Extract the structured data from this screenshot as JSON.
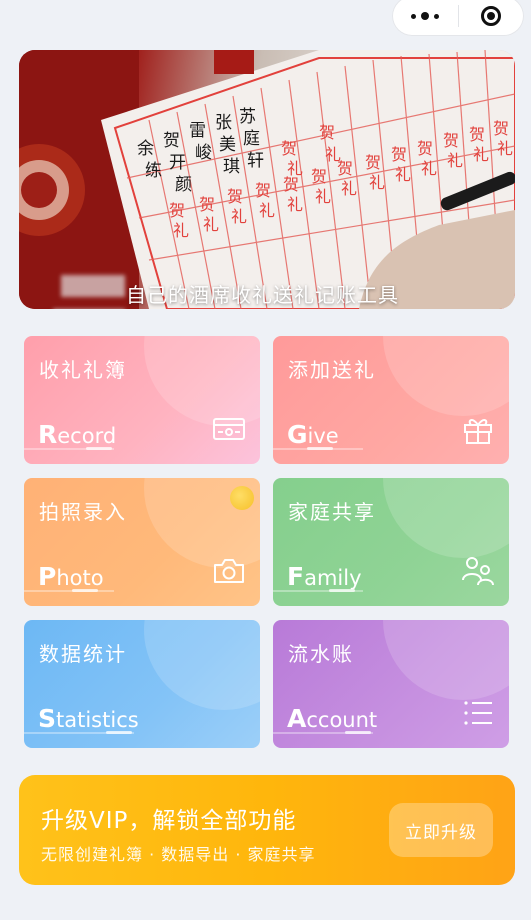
{
  "capsule": {
    "menu_icon": "more-dots-icon",
    "close_icon": "target-circle-icon"
  },
  "banner": {
    "caption": "自己的酒席收礼送礼记账工具",
    "slide_count": 3,
    "active_slide": 1
  },
  "cards": [
    {
      "key": "record",
      "title": "收礼礼簿",
      "en_initial": "R",
      "en_rest": "ecord",
      "icon": "ledger-icon"
    },
    {
      "key": "give",
      "title": "添加送礼",
      "en_initial": "G",
      "en_rest": "ive",
      "icon": "gift-icon"
    },
    {
      "key": "photo",
      "title": "拍照录入",
      "en_initial": "P",
      "en_rest": "hoto",
      "icon": "camera-icon"
    },
    {
      "key": "family",
      "title": "家庭共享",
      "en_initial": "F",
      "en_rest": "amily",
      "icon": "people-icon"
    },
    {
      "key": "stat",
      "title": "数据统计",
      "en_initial": "S",
      "en_rest": "tatistics",
      "icon": "stats-icon"
    },
    {
      "key": "account",
      "title": "流水账",
      "en_initial": "A",
      "en_rest": "ccount",
      "icon": "list-icon"
    }
  ],
  "vip": {
    "title": "升级VIP，解锁全部功能",
    "subtitle": "无限创建礼簿 · 数据导出 · 家庭共享",
    "button": "立即升级"
  },
  "colors": {
    "record": "#ff9fab",
    "give": "#ff9a9a",
    "photo": "#ffb176",
    "family": "#85cf8d",
    "stat": "#6db8f4",
    "account": "#b87ad8",
    "vip": "#ffb60c"
  }
}
